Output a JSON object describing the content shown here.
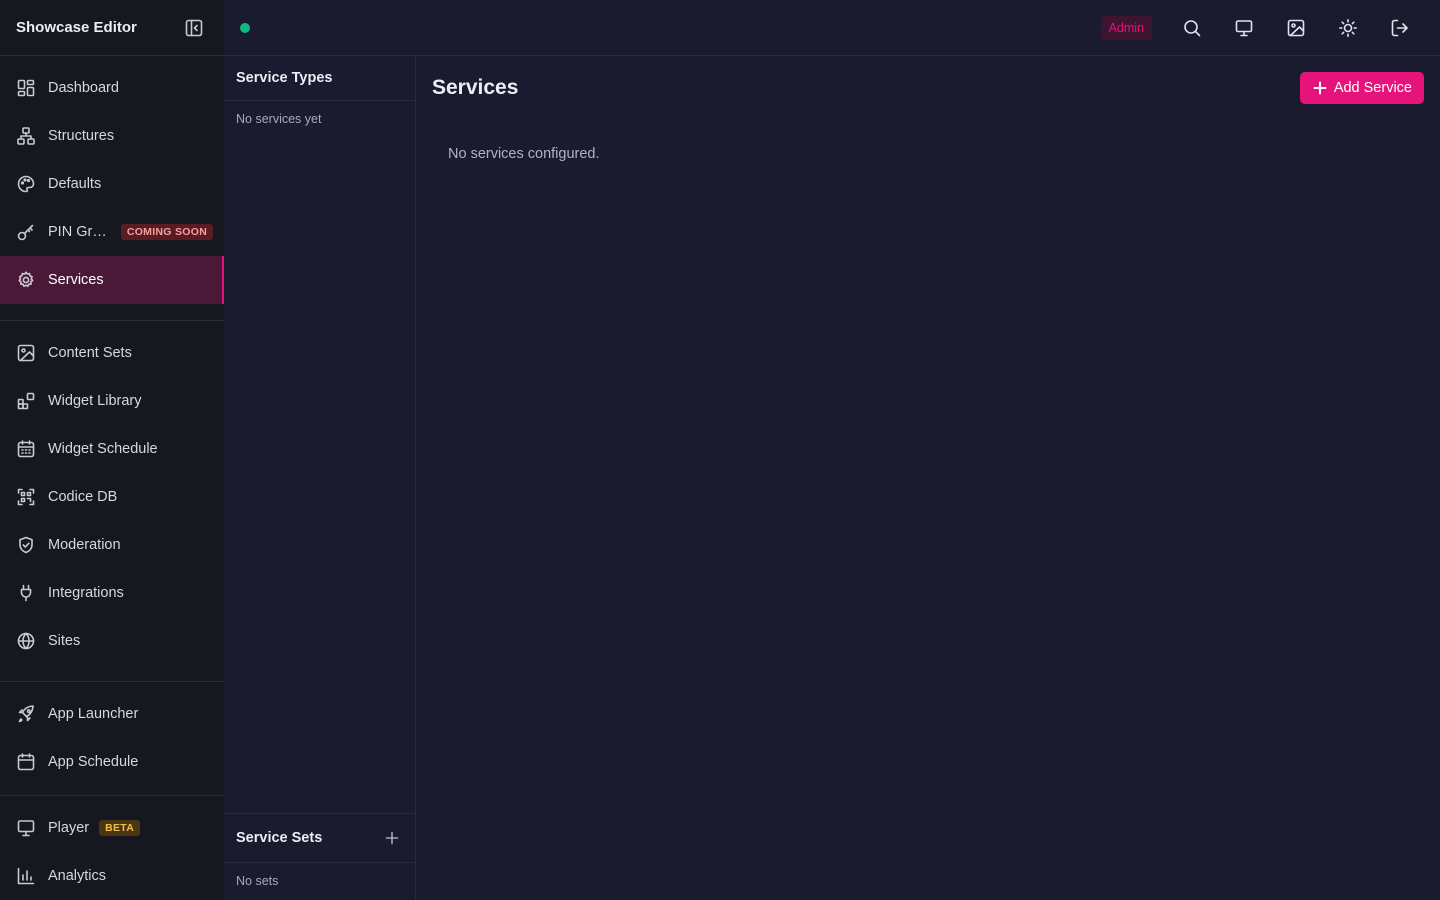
{
  "app": {
    "title": "Showcase Editor"
  },
  "sidebar": {
    "primary": [
      {
        "label": "Dashboard",
        "icon": "dashboard-icon"
      },
      {
        "label": "Structures",
        "icon": "structures-icon"
      },
      {
        "label": "Defaults",
        "icon": "palette-icon"
      },
      {
        "label": "PIN Gr…",
        "icon": "key-icon",
        "badge": "COMING SOON"
      },
      {
        "label": "Services",
        "icon": "gear-icon",
        "active": true
      }
    ],
    "secondary": [
      {
        "label": "Content Sets",
        "icon": "image-icon"
      },
      {
        "label": "Widget Library",
        "icon": "widgets-icon"
      },
      {
        "label": "Widget Schedule",
        "icon": "calendar-icon"
      },
      {
        "label": "Codice DB",
        "icon": "qr-icon"
      },
      {
        "label": "Moderation",
        "icon": "shield-check-icon"
      },
      {
        "label": "Integrations",
        "icon": "plug-icon"
      },
      {
        "label": "Sites",
        "icon": "globe-icon"
      }
    ],
    "tertiary": [
      {
        "label": "App Launcher",
        "icon": "rocket-icon"
      },
      {
        "label": "App Schedule",
        "icon": "calendar-icon"
      }
    ],
    "bottom": [
      {
        "label": "Player",
        "icon": "monitor-icon",
        "badge": "BETA"
      },
      {
        "label": "Analytics",
        "icon": "bar-chart-icon"
      }
    ]
  },
  "topbar": {
    "role": "Admin",
    "status_color": "#10b981",
    "actions": [
      "search-icon",
      "monitor-icon",
      "image-icon",
      "sun-icon",
      "logout-icon"
    ]
  },
  "service_types": {
    "title": "Service Types",
    "empty": "No services yet"
  },
  "service_sets": {
    "title": "Service Sets",
    "empty": "No sets"
  },
  "main": {
    "title": "Services",
    "add_label": "Add Service",
    "empty": "No services configured."
  },
  "colors": {
    "accent": "#e6137b",
    "background": "#1b1b2f",
    "sidebar": "#17171f"
  }
}
